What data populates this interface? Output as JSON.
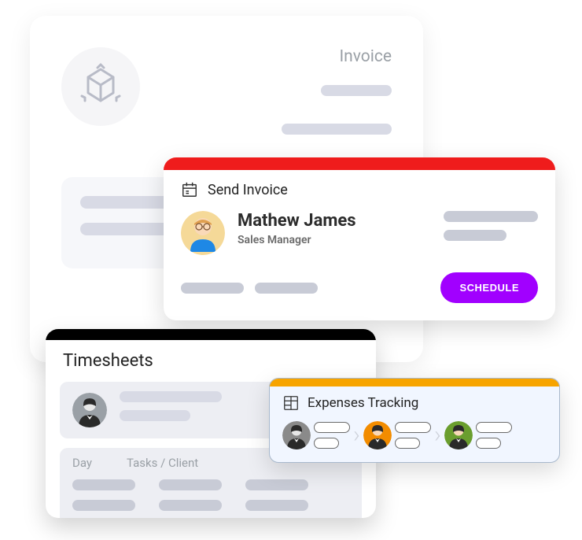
{
  "invoice": {
    "label": "Invoice"
  },
  "sendInvoice": {
    "title": "Send Invoice",
    "name": "Mathew James",
    "role": "Sales Manager",
    "scheduleLabel": "SCHEDULE",
    "accentColor": "#ef1c1c"
  },
  "timesheets": {
    "title": "Timesheets",
    "columns": [
      "Day",
      "Tasks / Client"
    ]
  },
  "expenses": {
    "title": "Expenses Tracking",
    "accentColor": "#f7a400"
  }
}
